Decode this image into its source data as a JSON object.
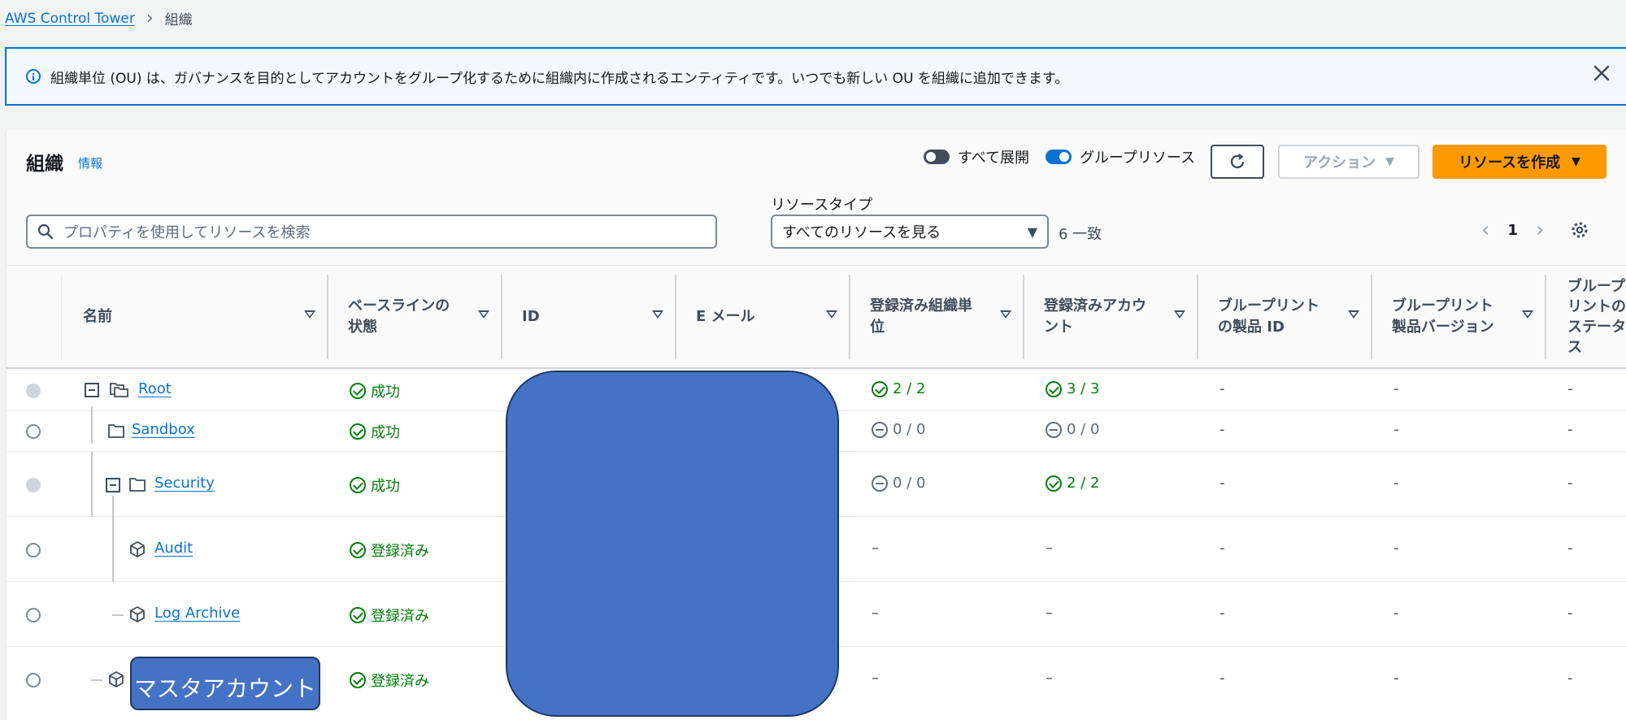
{
  "breadcrumb": {
    "root": "AWS Control Tower",
    "current": "組織"
  },
  "banner": {
    "message": "組織単位 (OU) は、ガバナンスを目的としてアカウントをグループ化するために組織内に作成されるエンティティです。いつでも新しい OU を組織に追加できます。"
  },
  "header": {
    "title": "組織",
    "info_link": "情報",
    "toggle_expand_label": "すべて展開",
    "toggle_group_label": "グループリソース",
    "action_label": "アクション",
    "create_label": "リソースを作成"
  },
  "filter": {
    "search_placeholder": "プロパティを使用してリソースを検索",
    "resource_type_label": "リソースタイプ",
    "resource_type_value": "すべてのリソースを見る",
    "match_count": "6 一致",
    "page": "1"
  },
  "columns": [
    {
      "l1": "名前",
      "l2": ""
    },
    {
      "l1": "ベースラインの",
      "l2": "状態"
    },
    {
      "l1": "ID",
      "l2": ""
    },
    {
      "l1": "E メール",
      "l2": ""
    },
    {
      "l1": "登録済み組織単",
      "l2": "位"
    },
    {
      "l1": "登録済みアカウ",
      "l2": "ント"
    },
    {
      "l1": "ブループリント",
      "l2": "の製品 ID"
    },
    {
      "l1": "ブループリント",
      "l2": "製品バージョン"
    },
    {
      "l1": "ブループ",
      "l2": "リントの",
      "l3": "ステータ",
      "l4": "ス"
    }
  ],
  "rows": [
    {
      "name": "Root",
      "status": "成功",
      "ou": "2 / 2",
      "acct": "3 / 3",
      "bp_id": "-",
      "bp_ver": "-",
      "bp_status": "-"
    },
    {
      "name": "Sandbox",
      "status": "成功",
      "ou": "0 / 0",
      "acct": "0 / 0",
      "bp_id": "-",
      "bp_ver": "-",
      "bp_status": "-"
    },
    {
      "name": "Security",
      "status": "成功",
      "ou": "0 / 0",
      "acct": "2 / 2",
      "bp_id": "-",
      "bp_ver": "-",
      "bp_status": "-"
    },
    {
      "name": "Audit",
      "status": "登録済み",
      "ou": "–",
      "acct": "–",
      "bp_id": "-",
      "bp_ver": "-",
      "bp_status": "-"
    },
    {
      "name": "Log Archive",
      "status": "登録済み",
      "ou": "–",
      "acct": "–",
      "bp_id": "-",
      "bp_ver": "-",
      "bp_status": "-"
    },
    {
      "name": "マスタアカウント",
      "status": "登録済み",
      "ou": "–",
      "acct": "–",
      "bp_id": "-",
      "bp_ver": "-",
      "bp_status": "-"
    }
  ],
  "colors": {
    "link": "#0972d3",
    "success": "#037f0c",
    "primary": "#ff9900",
    "redaction": "#4472c4"
  }
}
